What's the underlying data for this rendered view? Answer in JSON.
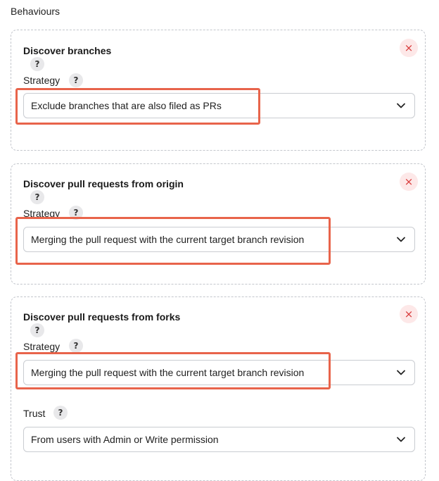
{
  "section": {
    "title": "Behaviours"
  },
  "cards": [
    {
      "title": "Discover branches",
      "strategy_label": "Strategy",
      "strategy_value": "Exclude branches that are also filed as PRs"
    },
    {
      "title": "Discover pull requests from origin",
      "strategy_label": "Strategy",
      "strategy_value": "Merging the pull request with the current target branch revision"
    },
    {
      "title": "Discover pull requests from forks",
      "strategy_label": "Strategy",
      "strategy_value": "Merging the pull request with the current target branch revision",
      "trust_label": "Trust",
      "trust_value": "From users with Admin or Write permission"
    }
  ],
  "icons": {
    "help": "?",
    "close": "×",
    "chevron": "chevron-down-icon"
  },
  "colors": {
    "highlight": "#e8644b",
    "close_bg": "#fde8e8",
    "close_fg": "#d83a3a",
    "card_border": "#c3c6cc"
  }
}
